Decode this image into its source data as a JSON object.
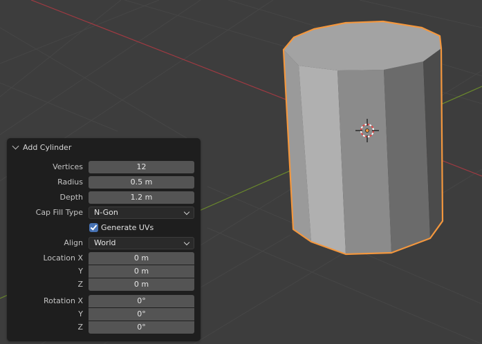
{
  "panel": {
    "title": "Add Cylinder",
    "vertices": {
      "label": "Vertices",
      "value": "12"
    },
    "radius": {
      "label": "Radius",
      "value": "0.5 m"
    },
    "depth": {
      "label": "Depth",
      "value": "1.2 m"
    },
    "cap_fill": {
      "label": "Cap Fill Type",
      "value": "N-Gon"
    },
    "generate_uvs": {
      "label": "Generate UVs",
      "checked": true
    },
    "align": {
      "label": "Align",
      "value": "World"
    },
    "location": {
      "x_label": "Location X",
      "x": "0 m",
      "y_label": "Y",
      "y": "0 m",
      "z_label": "Z",
      "z": "0 m"
    },
    "rotation": {
      "x_label": "Rotation X",
      "x": "0°",
      "y_label": "Y",
      "y": "0°",
      "z_label": "Z",
      "z": "0°"
    }
  },
  "colors": {
    "background": "#3d3d3d",
    "selection_outline": "#f3973e",
    "x_axis": "#a03a42",
    "y_axis": "#6b8a2c",
    "checkbox": "#4772b3"
  }
}
